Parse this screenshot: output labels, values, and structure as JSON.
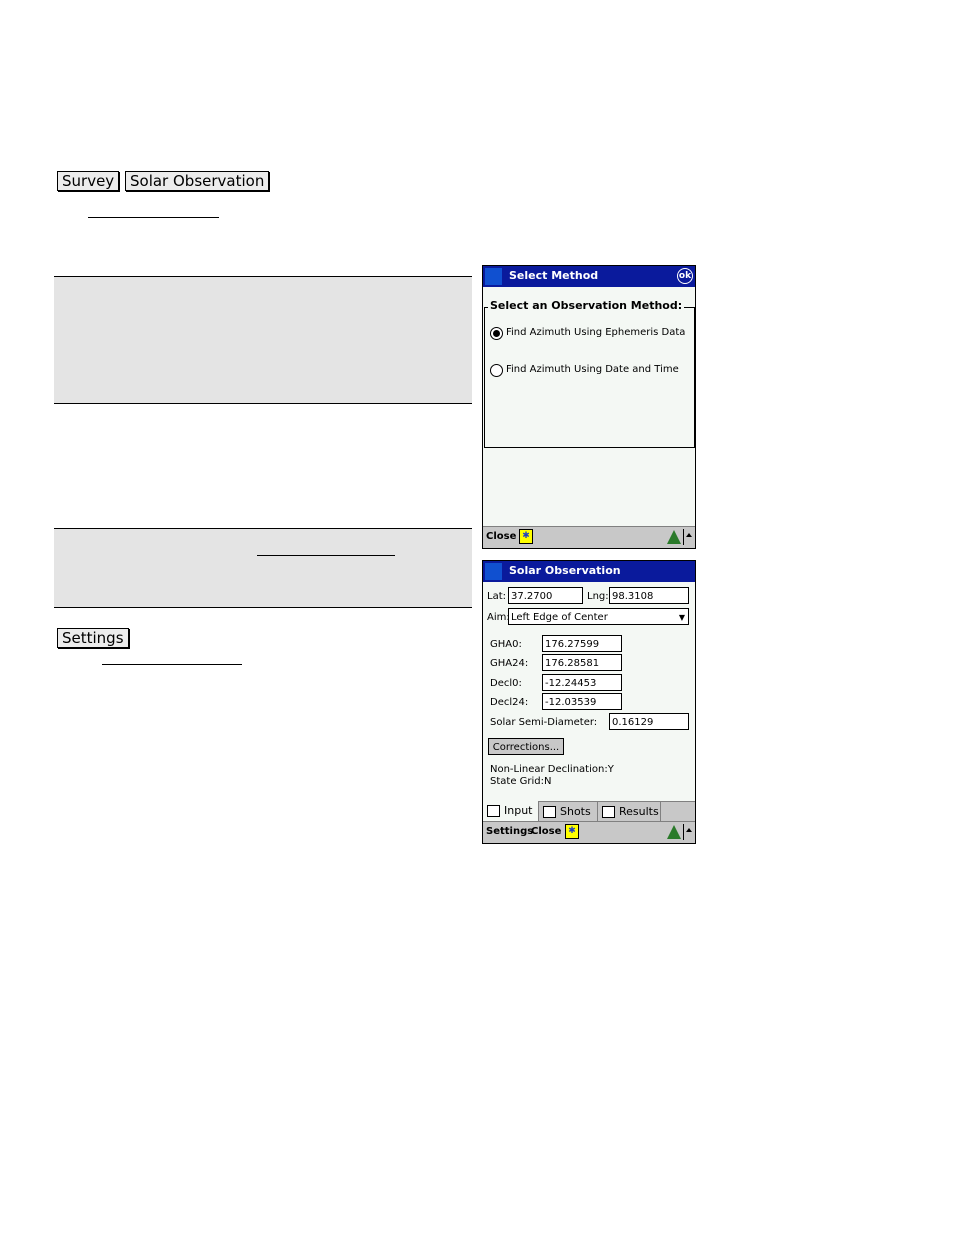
{
  "doc": {
    "breadcrumb": {
      "survey_label": "Survey",
      "solar_label": "Solar Observation"
    },
    "settings_label": "Settings"
  },
  "select_method_screen": {
    "title": "Select Method",
    "ok_label": "ok",
    "group_label": "Select an Observation Method:",
    "options": [
      {
        "label": "Find Azimuth Using Ephemeris Data",
        "selected": true
      },
      {
        "label": "Find Azimuth Using Date and Time",
        "selected": false
      }
    ],
    "cmdbar": {
      "close_label": "Close"
    }
  },
  "solar_screen": {
    "title": "Solar Observation",
    "lat_label": "Lat:",
    "lat_value": "37.2700",
    "lng_label": "Lng:",
    "lng_value": "98.3108",
    "aim_label": "Aim:",
    "aim_value": "Left Edge of Center",
    "fields": [
      {
        "label": "GHA0:",
        "value": "176.27599"
      },
      {
        "label": "GHA24:",
        "value": "176.28581"
      },
      {
        "label": "Decl0:",
        "value": "-12.24453"
      },
      {
        "label": "Decl24:",
        "value": "-12.03539"
      }
    ],
    "semi_diameter_label": "Solar Semi-Diameter:",
    "semi_diameter_value": "0.16129",
    "corrections_label": "Corrections...",
    "status_lines": [
      "Non-Linear Declination:Y",
      "State Grid:N"
    ],
    "tabs": [
      {
        "label": "Input",
        "active": true
      },
      {
        "label": "Shots",
        "active": false
      },
      {
        "label": "Results",
        "active": false
      }
    ],
    "cmdbar": {
      "settings_label": "Settings",
      "close_label": "Close"
    }
  }
}
